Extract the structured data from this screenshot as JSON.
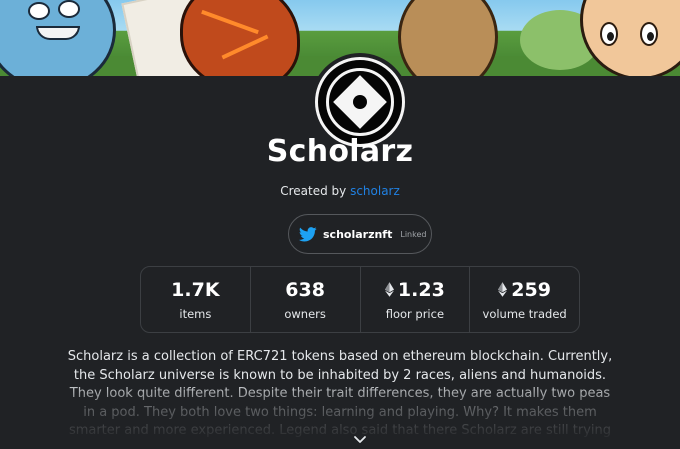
{
  "collection": {
    "name": "Scholarz",
    "created_by_prefix": "Created by",
    "creator": "scholarz"
  },
  "social": {
    "twitter_handle": "scholarznft",
    "linked_label": "Linked"
  },
  "stats": [
    {
      "value": "1.7K",
      "label": "items",
      "eth": false
    },
    {
      "value": "638",
      "label": "owners",
      "eth": false
    },
    {
      "value": "1.23",
      "label": "floor price",
      "eth": true
    },
    {
      "value": "259",
      "label": "volume traded",
      "eth": true
    }
  ],
  "description": "Scholarz is a collection of ERC721 tokens based on ethereum blockchain. Currently, the Scholarz universe is known to be inhabited by 2 races, aliens and humanoids. They look quite different. Despite their trait differences, they are actually two peas in a pod. They both love two things: learning and playing. Why? It makes them smarter and more experienced. Legend also said that there Scholarz are still trying to discover their long lost companions. With each passing",
  "colors": {
    "background": "#202225",
    "link": "#2081e2",
    "twitter": "#1da1f2"
  },
  "icons": {
    "twitter": "twitter-icon",
    "eth": "ethereum-icon",
    "expand": "chevron-down-icon"
  }
}
